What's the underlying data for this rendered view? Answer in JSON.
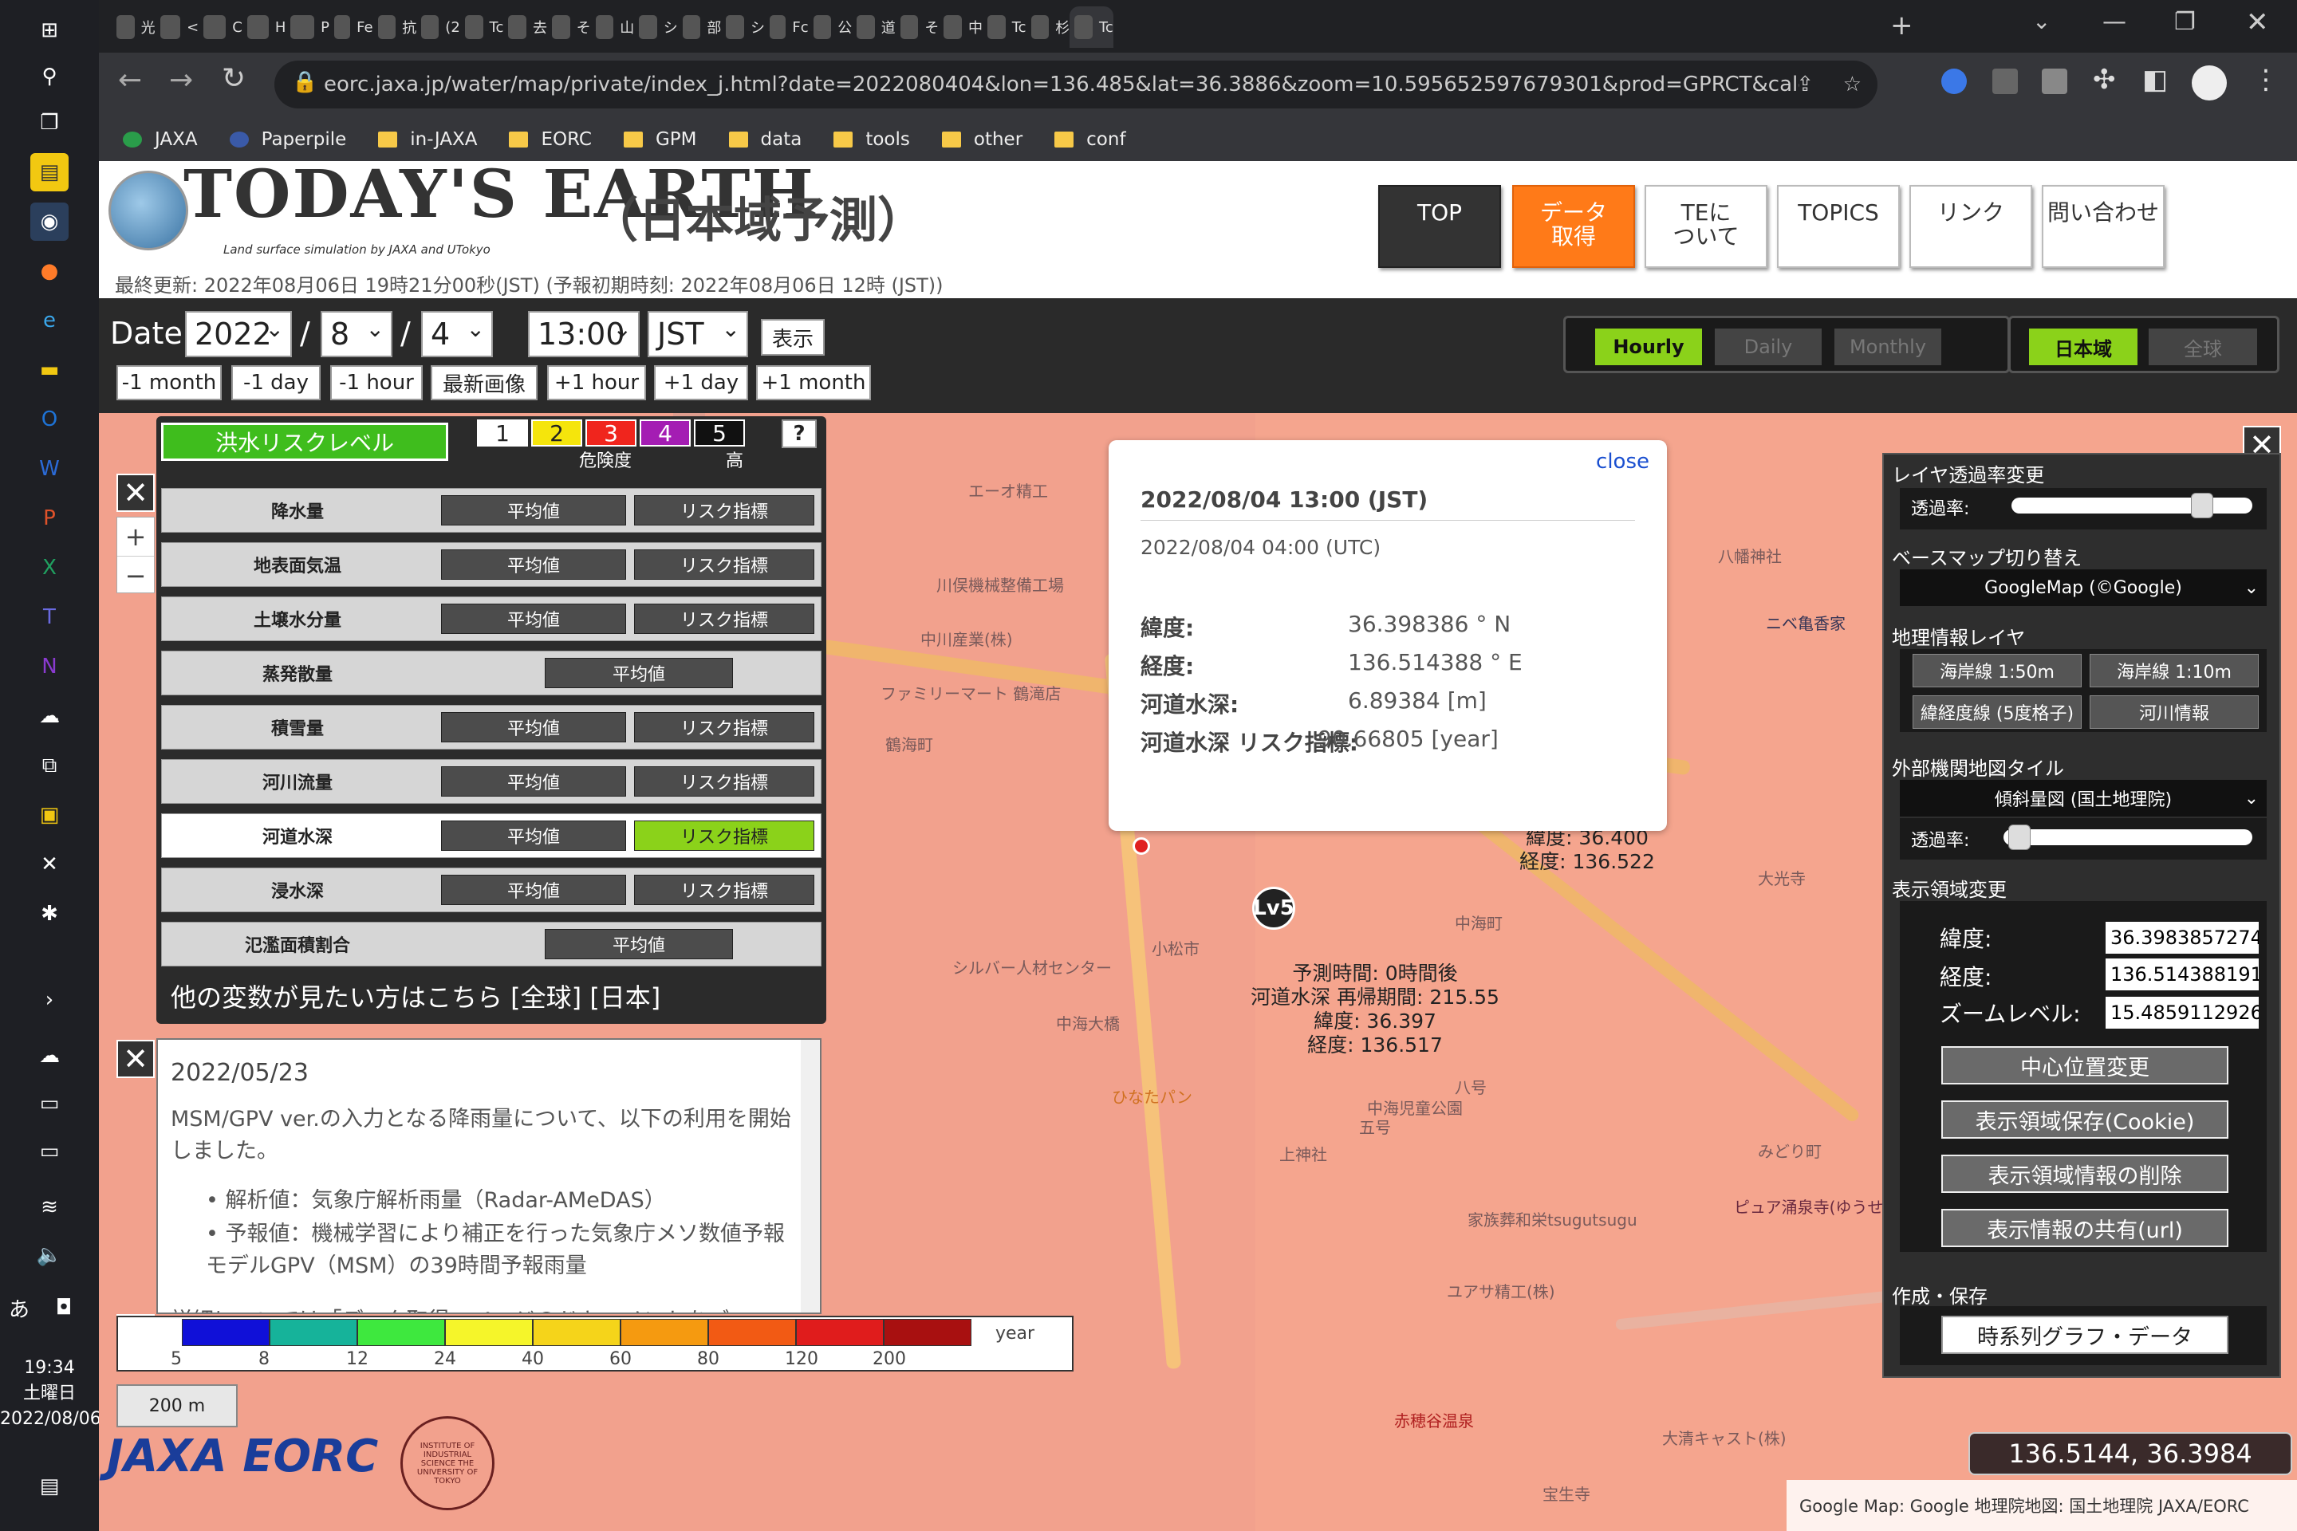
{
  "taskbar": {
    "time": "19:34",
    "weekday": "土曜日",
    "date": "2022/08/06",
    "ime": "あ"
  },
  "browser": {
    "url": "eorc.jaxa.jp/water/map/private/index_j.html?date=2022080404&lon=136.485&lat=36.3886&zoom=10.595652597679301&prod=GPRCT&calc=ave",
    "tabs": [
      "光",
      "<",
      "C",
      "H",
      "P",
      "Fe",
      "抗",
      "(2",
      "Tc",
      "去",
      "そ",
      "山",
      "シ",
      "部",
      "シ",
      "Fc",
      "公",
      "道",
      "そ",
      "中",
      "Tc",
      "杉",
      "Tc"
    ],
    "bookmarks": [
      "JAXA",
      "Paperpile",
      "in-JAXA",
      "EORC",
      "GPM",
      "data",
      "tools",
      "other",
      "conf"
    ]
  },
  "header": {
    "logo": "TODAY'S EARTH",
    "logo_sub": "Land surface simulation by JAXA and UTokyo",
    "title_jp": "（日本域予測）",
    "updated": "最終更新: 2022年08月06日 19時21分00秒(JST) (予報初期時刻: 2022年08月06日 12時 (JST))",
    "nav": [
      "TOP",
      "データ\n取得",
      "TEに\nついて",
      "TOPICS",
      "リンク",
      "問い合わせ"
    ]
  },
  "dateRow": {
    "label": "Date:",
    "year": "2022",
    "month": "8",
    "day": "4",
    "time": "13:00",
    "tz": "JST",
    "show": "表示",
    "steps": [
      "-1 month",
      "-1 day",
      "-1 hour",
      "最新画像",
      "+1 hour",
      "+1 day",
      "+1 month"
    ],
    "modes": [
      "Hourly",
      "Daily",
      "Monthly"
    ],
    "regions": [
      "日本域",
      "全球"
    ]
  },
  "risk": {
    "title": "洪水リスクレベル",
    "levels": [
      "1",
      "2",
      "3",
      "4",
      "5"
    ],
    "level_colors": [
      "#ffffff",
      "#f5e50c",
      "#f0251d",
      "#a41db3",
      "#111111"
    ],
    "danger": "危険度",
    "high": "高",
    "help": "?",
    "avg": "平均値",
    "riskidx": "リスク指標",
    "vars": [
      "降水量",
      "地表面気温",
      "土壌水分量",
      "蒸発散量",
      "積雪量",
      "河川流量",
      "河道水深",
      "浸水深",
      "氾濫面積割合"
    ],
    "more": "他の変数が見たい方はこちら [全球] [日本]"
  },
  "popup": {
    "close": "close",
    "jst": "2022/08/04 13:00 (JST)",
    "utc": "2022/08/04 04:00 (UTC)",
    "rows": [
      {
        "k": "緯度:",
        "v": "36.398386 ° N"
      },
      {
        "k": "経度:",
        "v": "136.514388 ° E"
      },
      {
        "k": "河道水深:",
        "v": "6.89384 [m]"
      },
      {
        "k": "河道水深 リスク指標:",
        "v": "90.66805 [year]"
      }
    ]
  },
  "map": {
    "marker": "Lv5",
    "label_a": "予測時間: 0時間後",
    "label_b": "河道水深 再帰期間: 215.55",
    "label_c": "緯度: 36.397",
    "label_d": "経度: 136.517",
    "label_e": "緯度: 36.400",
    "label_f": "経度: 136.522",
    "places": [
      "エーオ精工",
      "川俣機械整備工場",
      "ファミリーマート 鶴滝店",
      "鶴海町",
      "中川産業(株)",
      "シルバー人材センター",
      "小松市",
      "中海大橋",
      "ひなたパン",
      "中海児童公園",
      "家族葬和栄tsugutsugu",
      "ピュア涌泉寺(ゆうせんじ)",
      "みどり町",
      "ユアサ精工(株)",
      "赤穂谷温泉",
      "八幡神社",
      "ニベ亀香家",
      "大光寺",
      "中海町",
      "五号",
      "八号",
      "上神社",
      "大清キャスト(株)",
      "宝生寺"
    ],
    "scale": "200 m",
    "coord": "136.5144, 36.3984",
    "attribution": "Google Map: Google  地理院地図: 国土地理院  JAXA/EORC"
  },
  "news": {
    "date": "2022/05/23",
    "p1": "MSM/GPV ver.の入力となる降雨量について、以下の利用を開始しました。",
    "b1": "解析値：気象庁解析雨量（Radar-AMeDAS）",
    "b2": "予報値：機械学習により補正を行った気象庁メソ数値予報モデルGPV（MSM）の39時間予報雨量",
    "p2": "詳細については「データ取得」ページのドキュメントをご"
  },
  "legend": {
    "colors": [
      "#1010d8",
      "#16b39a",
      "#3ee83e",
      "#f5f52a",
      "#f5d41a",
      "#f59a10",
      "#f25a14",
      "#e01c1c",
      "#a81010"
    ],
    "labels": [
      "5",
      "8",
      "12",
      "24",
      "40",
      "60",
      "80",
      "120",
      "200"
    ],
    "unit": "year"
  },
  "rightPanel": {
    "opacity_title": "レイヤ透過率変更",
    "opacity_label": "透過率:",
    "opacity_value": 0.82,
    "basemap_title": "ベースマップ切り替え",
    "basemap": "GoogleMap (©Google)",
    "geo_title": "地理情報レイヤ",
    "geo_buttons": [
      "海岸線 1:50m",
      "海岸線 1:10m",
      "緯経度線 (5度格子)",
      "河川情報"
    ],
    "ext_title": "外部機関地図タイル",
    "ext_select": "傾斜量図 (国土地理院)",
    "ext_opacity_value": 0.02,
    "area_title": "表示領域変更",
    "lat_label": "緯度:",
    "lat": "36.3983857274",
    "lon_label": "経度:",
    "lon": "136.514388191",
    "zoom_label": "ズームレベル:",
    "zoom": "15.4859112926",
    "buttons": [
      "中心位置変更",
      "表示領域保存(Cookie)",
      "表示領域情報の削除",
      "表示情報の共有(url)"
    ],
    "save_title": "作成・保存",
    "graph": "時系列グラフ・データ"
  },
  "footer": {
    "jaxa": "JAXA EORC",
    "utokyo": "INSTITUTE OF INDUSTRIAL SCIENCE THE UNIVERSITY OF TOKYO"
  }
}
